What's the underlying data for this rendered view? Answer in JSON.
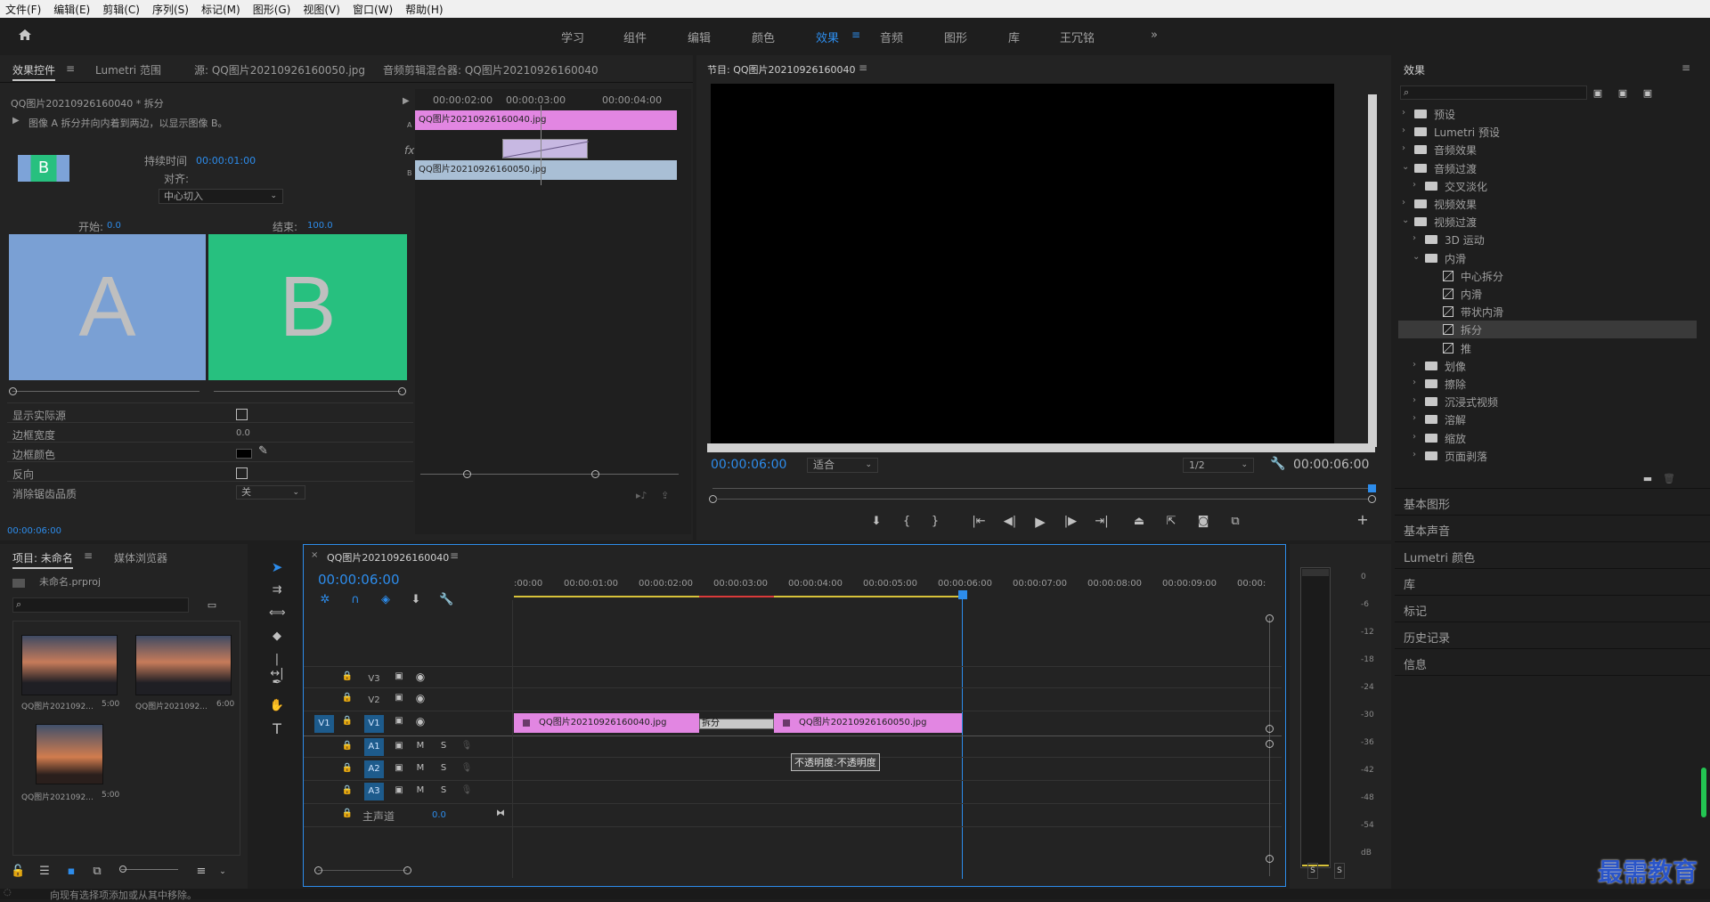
{
  "menu": [
    "文件(F)",
    "编辑(E)",
    "剪辑(C)",
    "序列(S)",
    "标记(M)",
    "图形(G)",
    "视图(V)",
    "窗口(W)",
    "帮助(H)"
  ],
  "workspaces": [
    "学习",
    "组件",
    "编辑",
    "颜色",
    "效果",
    "音频",
    "图形",
    "库",
    "王冗铭"
  ],
  "workspace_active": "效果",
  "effect_controls": {
    "tabs": [
      "效果控件",
      "Lumetri 范围",
      "源: QQ图片20210926160050.jpg",
      "音频剪辑混合器: QQ图片20210926160040"
    ],
    "clip_header": "QQ图片20210926160040 * 拆分",
    "description": "图像 A 拆分并向内着到两边，以显示图像 B。",
    "duration_label": "持续时间",
    "duration_value": "00:00:01:00",
    "align_label": "对齐:",
    "align_value": "中心切入",
    "start_label": "开始:",
    "start_value": "0.0",
    "end_label": "结束:",
    "end_value": "100.0",
    "preview_a": "A",
    "preview_b": "B",
    "mini_preview": "B",
    "ruler": [
      "00:00:02:00",
      "00:00:03:00",
      "00:00:04:00"
    ],
    "clip_a": "QQ图片20210926160040.jpg",
    "clip_b": "QQ图片20210926160050.jpg",
    "track_a": "A",
    "track_b": "B",
    "fx_label": "fx",
    "props": [
      {
        "label": "显示实际源",
        "type": "checkbox"
      },
      {
        "label": "边框宽度",
        "value": "0.0"
      },
      {
        "label": "边框颜色",
        "type": "color"
      },
      {
        "label": "反向",
        "type": "checkbox"
      },
      {
        "label": "消除锯齿品质",
        "value": "关"
      }
    ],
    "timecode": "00:00:06:00"
  },
  "program": {
    "title": "节目: QQ图片20210926160040",
    "timecode": "00:00:06:00",
    "fit": "适合",
    "resolution": "1/2",
    "duration": "00:00:06:00"
  },
  "effects_panel": {
    "title": "效果",
    "tree": [
      {
        "label": "预设",
        "level": 0,
        "kind": "folder",
        "open": false
      },
      {
        "label": "Lumetri 预设",
        "level": 0,
        "kind": "folder",
        "open": false
      },
      {
        "label": "音频效果",
        "level": 0,
        "kind": "folder",
        "open": false
      },
      {
        "label": "音频过渡",
        "level": 0,
        "kind": "folder",
        "open": true
      },
      {
        "label": "交叉淡化",
        "level": 1,
        "kind": "folder",
        "open": false
      },
      {
        "label": "视频效果",
        "level": 0,
        "kind": "folder",
        "open": false
      },
      {
        "label": "视频过渡",
        "level": 0,
        "kind": "folder",
        "open": true
      },
      {
        "label": "3D 运动",
        "level": 1,
        "kind": "folder",
        "open": false
      },
      {
        "label": "内滑",
        "level": 1,
        "kind": "folder",
        "open": true
      },
      {
        "label": "中心拆分",
        "level": 2,
        "kind": "fx"
      },
      {
        "label": "内滑",
        "level": 2,
        "kind": "fx"
      },
      {
        "label": "带状内滑",
        "level": 2,
        "kind": "fx"
      },
      {
        "label": "拆分",
        "level": 2,
        "kind": "fx",
        "selected": true
      },
      {
        "label": "推",
        "level": 2,
        "kind": "fx"
      },
      {
        "label": "划像",
        "level": 1,
        "kind": "folder",
        "open": false
      },
      {
        "label": "擦除",
        "level": 1,
        "kind": "folder",
        "open": false
      },
      {
        "label": "沉浸式视频",
        "level": 1,
        "kind": "folder",
        "open": false
      },
      {
        "label": "溶解",
        "level": 1,
        "kind": "folder",
        "open": false
      },
      {
        "label": "缩放",
        "level": 1,
        "kind": "folder",
        "open": false
      },
      {
        "label": "页面剥落",
        "level": 1,
        "kind": "folder",
        "open": false
      }
    ],
    "side_panels": [
      "基本图形",
      "基本声音",
      "Lumetri 颜色",
      "库",
      "标记",
      "历史记录",
      "信息"
    ]
  },
  "project": {
    "tabs": [
      "项目: 未命名",
      "媒体浏览器"
    ],
    "file": "未命名.prproj",
    "items": [
      {
        "name": "QQ图片2021092...",
        "dur": "5:00"
      },
      {
        "name": "QQ图片2021092...",
        "dur": "6:00"
      },
      {
        "name": "QQ图片2021092...",
        "dur": "5:00"
      }
    ]
  },
  "timeline": {
    "tab": "QQ图片20210926160040",
    "timecode": "00:00:06:00",
    "ruler": [
      ":00:00",
      "00:00:01:00",
      "00:00:02:00",
      "00:00:03:00",
      "00:00:04:00",
      "00:00:05:00",
      "00:00:06:00",
      "00:00:07:00",
      "00:00:08:00",
      "00:00:09:00",
      "00:00:"
    ],
    "video_tracks": [
      "V3",
      "V2",
      "V1"
    ],
    "audio_tracks": [
      "A1",
      "A2",
      "A3"
    ],
    "source_patch": "V1",
    "master_label": "主声道",
    "master_value": "0.0",
    "clip1": "QQ图片20210926160040.jpg",
    "transition": "拆分",
    "clip2": "QQ图片20210926160050.jpg",
    "tooltip": "不透明度:不透明度",
    "mute": "M",
    "solo": "S"
  },
  "meter": {
    "labels": [
      "0",
      "-6",
      "-12",
      "-18",
      "-24",
      "-30",
      "-36",
      "-42",
      "-48",
      "-54",
      "dB"
    ],
    "solo_buttons": [
      "S",
      "S"
    ]
  },
  "status": "向现有选择项添加或从其中移除。",
  "watermark": "最需教育"
}
